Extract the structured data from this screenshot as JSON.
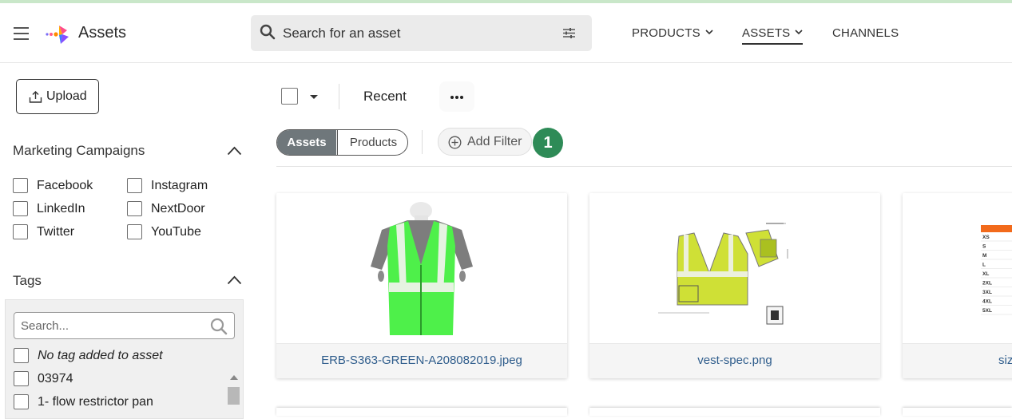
{
  "app": {
    "title": "Assets"
  },
  "search": {
    "placeholder": "Search for an asset"
  },
  "nav": [
    {
      "label": "PRODUCTS",
      "has_dropdown": true,
      "active": false
    },
    {
      "label": "ASSETS",
      "has_dropdown": true,
      "active": true
    },
    {
      "label": "CHANNELS",
      "has_dropdown": false,
      "active": false
    }
  ],
  "sidebar": {
    "upload_label": "Upload",
    "marketing_title": "Marketing Campaigns",
    "campaigns": [
      "Facebook",
      "Instagram",
      "LinkedIn",
      "NextDoor",
      "Twitter",
      "YouTube"
    ],
    "tags_title": "Tags",
    "tag_search_placeholder": "Search...",
    "tags": [
      "No tag added to asset",
      "03974",
      "1- flow restrictor pan"
    ]
  },
  "toolbar": {
    "recent_label": "Recent",
    "seg_assets": "Assets",
    "seg_products": "Products",
    "add_filter_label": "Add Filter",
    "badge_count": "1"
  },
  "cards": [
    {
      "filename": "ERB-S363-GREEN-A208082019.jpeg"
    },
    {
      "filename": "vest-spec.png"
    },
    {
      "filename": "siz"
    }
  ],
  "size_chart_labels": [
    "XS",
    "S",
    "M",
    "L",
    "XL",
    "2XL",
    "3XL",
    "4XL",
    "5XL"
  ],
  "colors": {
    "accent_green": "#2e8b57",
    "segment_active": "#6f777b",
    "link_blue": "#2f5d8c",
    "vest_green": "#4ef04a",
    "spec_yellow": "#cfe036"
  }
}
